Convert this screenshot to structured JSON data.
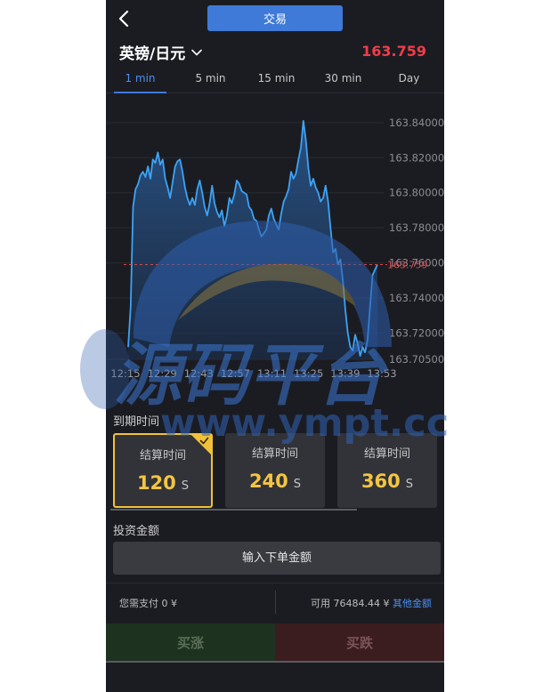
{
  "header": {
    "tab_label": "交易",
    "pair": "英镑/日元",
    "price": "163.759"
  },
  "timeframes": [
    {
      "label": "1 min",
      "active": true
    },
    {
      "label": "5 min",
      "active": false
    },
    {
      "label": "15 min",
      "active": false
    },
    {
      "label": "30 min",
      "active": false
    },
    {
      "label": "Day",
      "active": false
    }
  ],
  "chart_data": {
    "type": "line",
    "y_ticks": [
      "163.84000",
      "163.82000",
      "163.80000",
      "163.78000",
      "163.76000",
      "163.74000",
      "163.72000",
      "163.70500"
    ],
    "x_ticks": [
      "12:15",
      "12:29",
      "12:43",
      "12:57",
      "13:11",
      "13:25",
      "13:39",
      "13:53"
    ],
    "ylim": [
      163.705,
      163.845
    ],
    "current_price_label": "163.759",
    "current_price": 163.759,
    "line_color": "#3da3f5",
    "values": [
      163.712,
      163.735,
      163.792,
      163.802,
      163.805,
      163.81,
      163.812,
      163.809,
      163.815,
      163.808,
      163.819,
      163.817,
      163.823,
      163.816,
      163.819,
      163.808,
      163.803,
      163.797,
      163.806,
      163.815,
      163.818,
      163.819,
      163.812,
      163.803,
      163.797,
      163.793,
      163.797,
      163.793,
      163.802,
      163.807,
      163.8,
      163.792,
      163.787,
      163.794,
      163.804,
      163.794,
      163.789,
      163.786,
      163.79,
      163.781,
      163.787,
      163.797,
      163.794,
      163.799,
      163.807,
      163.805,
      163.801,
      163.8,
      163.799,
      163.792,
      163.79,
      163.785,
      163.784,
      163.779,
      163.775,
      163.777,
      163.779,
      163.787,
      163.791,
      163.785,
      163.782,
      163.779,
      163.788,
      163.795,
      163.798,
      163.802,
      163.812,
      163.808,
      163.811,
      163.819,
      163.826,
      163.841,
      163.83,
      163.814,
      163.804,
      163.808,
      163.803,
      163.8,
      163.795,
      163.797,
      163.804,
      163.795,
      163.78,
      163.766,
      163.768,
      163.759,
      163.762,
      163.75,
      163.733,
      163.72,
      163.712,
      163.71,
      163.719,
      163.714,
      163.707,
      163.712,
      163.709,
      163.716,
      163.735,
      163.753,
      163.756,
      163.759
    ]
  },
  "expiry": {
    "label": "到期时间",
    "options": [
      {
        "title": "结算时间",
        "value": "120",
        "unit": "S",
        "selected": true
      },
      {
        "title": "结算时间",
        "value": "240",
        "unit": "S",
        "selected": false
      },
      {
        "title": "结算时间",
        "value": "360",
        "unit": "S",
        "selected": false
      }
    ]
  },
  "amount": {
    "label": "投资金额",
    "placeholder": "输入下单金额"
  },
  "payment": {
    "need_pay_label": "您需支付",
    "need_pay_value": "0",
    "currency": "¥",
    "available_label": "可用",
    "available_value": "76484.44",
    "other_amount_link": "其他金额"
  },
  "actions": {
    "buy_up": "买涨",
    "buy_down": "买跌"
  },
  "watermark": {
    "text": "源码平台",
    "url": "www.ympt.cc"
  },
  "colors": {
    "background": "#1b1c22",
    "accent": "#3f7ad8",
    "price_red": "#f23c48",
    "gold": "#f4c542",
    "up_green": "#1e331f",
    "down_red": "#3b1d20"
  }
}
